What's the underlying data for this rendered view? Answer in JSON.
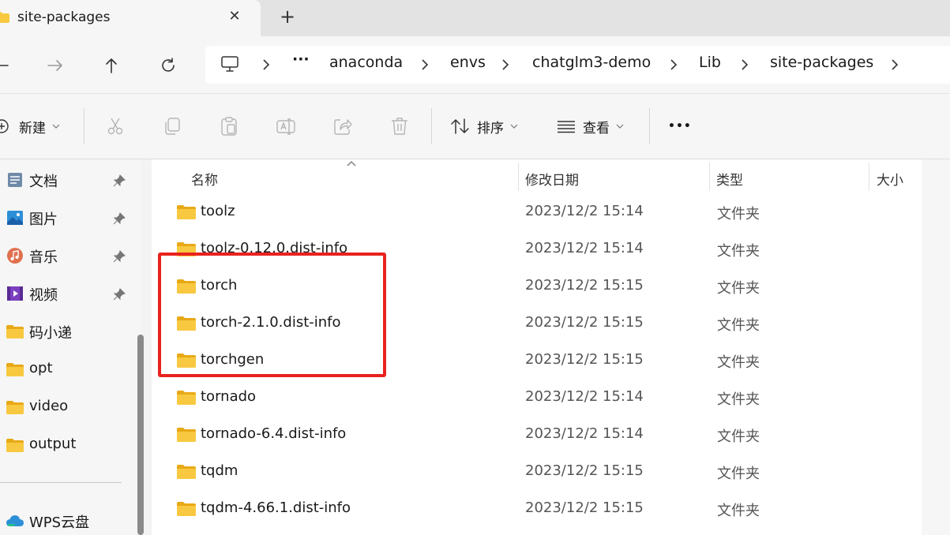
{
  "tab": {
    "title": "site-packages",
    "close_glyph": "✕",
    "new_glyph": "+"
  },
  "address": {
    "more_glyph": "···",
    "crumbs": [
      "anaconda",
      "envs",
      "chatglm3-demo",
      "Lib",
      "site-packages"
    ]
  },
  "toolbar": {
    "new_label": "新建",
    "sort_label": "排序",
    "view_label": "查看",
    "more_glyph": "•••"
  },
  "sidebar": {
    "items": [
      {
        "label": "文档",
        "icon": "document-icon",
        "pinned": true
      },
      {
        "label": "图片",
        "icon": "pictures-icon",
        "pinned": true
      },
      {
        "label": "音乐",
        "icon": "music-icon",
        "pinned": true
      },
      {
        "label": "视频",
        "icon": "video-icon",
        "pinned": true
      },
      {
        "label": "码小递",
        "icon": "folder-icon",
        "pinned": false
      },
      {
        "label": "opt",
        "icon": "folder-icon",
        "pinned": false
      },
      {
        "label": "video",
        "icon": "folder-icon",
        "pinned": false
      },
      {
        "label": "output",
        "icon": "folder-icon",
        "pinned": false
      }
    ],
    "cloud": {
      "label": "WPS云盘",
      "icon": "cloud-icon"
    }
  },
  "columns": {
    "name": "名称",
    "date": "修改日期",
    "type": "类型",
    "size": "大小"
  },
  "files": [
    {
      "name": "toolz",
      "date": "2023/12/2 15:14",
      "type": "文件夹"
    },
    {
      "name": "toolz-0.12.0.dist-info",
      "date": "2023/12/2 15:14",
      "type": "文件夹"
    },
    {
      "name": "torch",
      "date": "2023/12/2 15:15",
      "type": "文件夹"
    },
    {
      "name": "torch-2.1.0.dist-info",
      "date": "2023/12/2 15:15",
      "type": "文件夹"
    },
    {
      "name": "torchgen",
      "date": "2023/12/2 15:15",
      "type": "文件夹"
    },
    {
      "name": "tornado",
      "date": "2023/12/2 15:14",
      "type": "文件夹"
    },
    {
      "name": "tornado-6.4.dist-info",
      "date": "2023/12/2 15:14",
      "type": "文件夹"
    },
    {
      "name": "tqdm",
      "date": "2023/12/2 15:15",
      "type": "文件夹"
    },
    {
      "name": "tqdm-4.66.1.dist-info",
      "date": "2023/12/2 15:15",
      "type": "文件夹"
    }
  ],
  "colors": {
    "folder": "#f8c940",
    "folder_dark": "#e8a917",
    "highlight": "#e8231e",
    "accent": "#0067c0"
  }
}
